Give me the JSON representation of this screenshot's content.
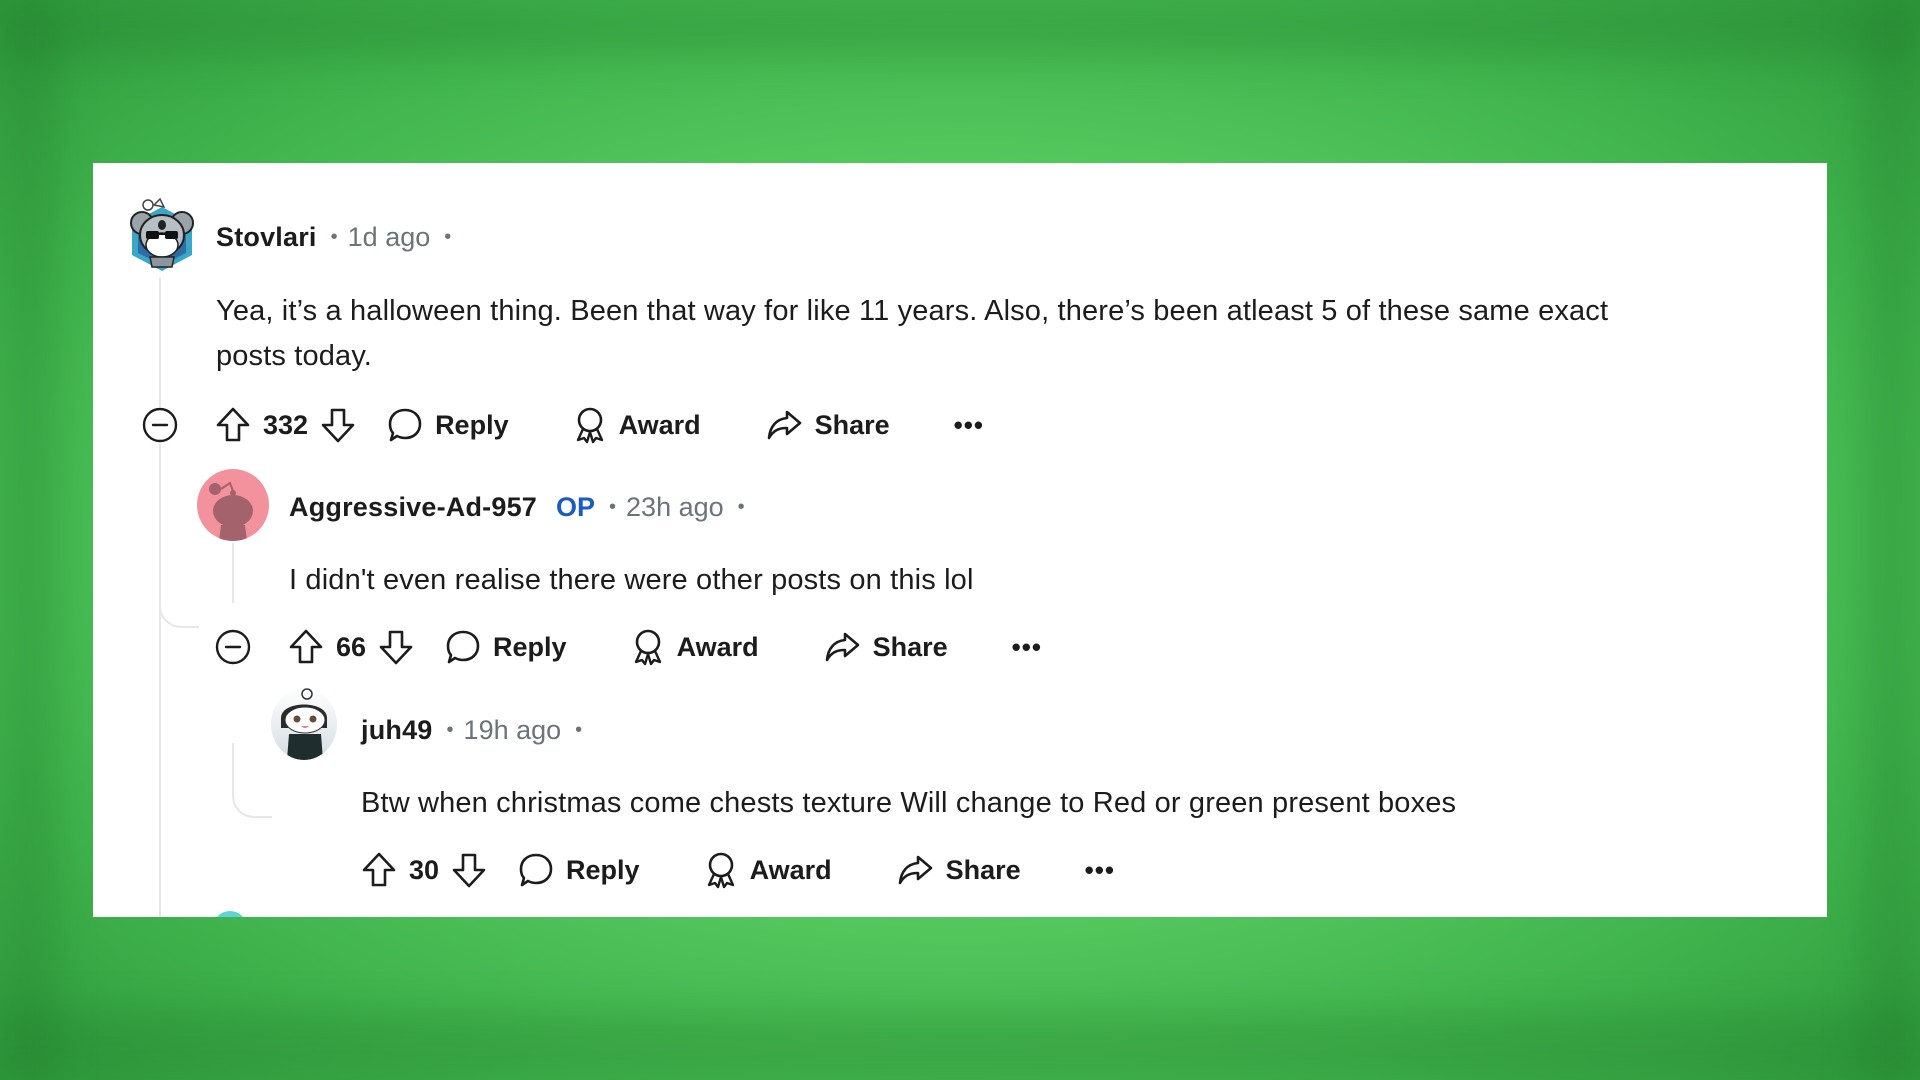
{
  "comments": [
    {
      "username": "Stovlari",
      "is_op": false,
      "time": "1d ago",
      "body_line1": "Yea, it’s a halloween thing. Been that way for like 11 years. Also, there’s been atleast 5 of these same exact",
      "body_line2": "posts today.",
      "votes": "332",
      "avatar": "koala-sunglasses-avatar"
    },
    {
      "username": "Aggressive-Ad-957",
      "is_op": true,
      "op_label": "OP",
      "time": "23h ago",
      "body_line1": "I didn't even realise there were other posts on this lol",
      "votes": "66",
      "avatar": "default-snoo-pink-avatar"
    },
    {
      "username": "juh49",
      "is_op": false,
      "time": "19h ago",
      "body_line1": "Btw when christmas come chests texture Will change to Red or green present boxes",
      "votes": "30",
      "avatar": "snoo-dark-hair-avatar"
    }
  ],
  "actions": {
    "reply": "Reply",
    "award": "Award",
    "share": "Share",
    "more": "•••"
  },
  "separator": "•",
  "colors": {
    "op_badge": "#1a5bc4",
    "meta_text": "#6a7479",
    "text": "#1c1c1c",
    "avatar_pink": "#f3929c",
    "background_green": "#5fd466"
  }
}
